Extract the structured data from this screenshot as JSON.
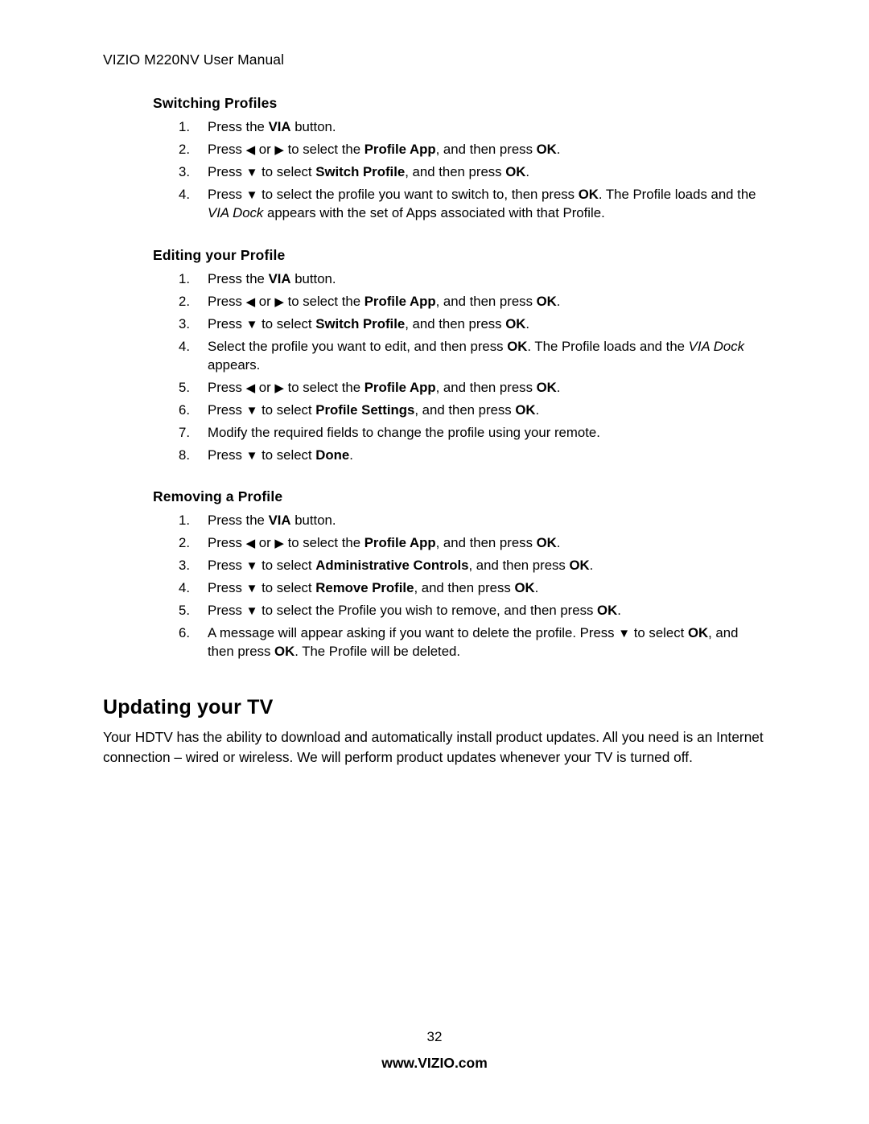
{
  "header": {
    "running_head": "VIZIO M220NV User Manual"
  },
  "sections": [
    {
      "heading": "Switching Profiles",
      "steps": [
        {
          "num": "1.",
          "html": "Press the <b>VIA</b> button."
        },
        {
          "num": "2.",
          "html": "Press <span class=\"tri\">&#9664;</span> or <span class=\"tri\">&#9654;</span> to select the <b>Profile App</b>, and then press <b>OK</b>."
        },
        {
          "num": "3.",
          "html": "Press <span class=\"tri\">&#9660;</span> to select <b>Switch Profile</b>, and then press <b>OK</b>."
        },
        {
          "num": "4.",
          "html": "Press <span class=\"tri\">&#9660;</span> to select the profile you want to switch to, then press <b>OK</b>. The Profile loads and the <i>VIA Dock</i> appears with the set of Apps associated with that Profile."
        }
      ]
    },
    {
      "heading": "Editing your Profile",
      "steps": [
        {
          "num": "1.",
          "html": "Press the <b>VIA</b> button."
        },
        {
          "num": "2.",
          "html": "Press <span class=\"tri\">&#9664;</span> or <span class=\"tri\">&#9654;</span> to select the <b>Profile App</b>, and then press <b>OK</b>."
        },
        {
          "num": "3.",
          "html": "Press <span class=\"tri\">&#9660;</span> to select <b>Switch Profile</b>, and then press <b>OK</b>."
        },
        {
          "num": "4.",
          "html": "Select the profile you want to edit, and then press <b>OK</b>. The Profile loads and the <i>VIA Dock</i> appears."
        },
        {
          "num": "5.",
          "html": "Press <span class=\"tri\">&#9664;</span> or <span class=\"tri\">&#9654;</span> to select the <b>Profile App</b>, and then press <b>OK</b>."
        },
        {
          "num": "6.",
          "html": "Press <span class=\"tri\">&#9660;</span> to select <b>Profile Settings</b>, and then press <b>OK</b>."
        },
        {
          "num": "7.",
          "html": "Modify the required fields to change the profile using your remote."
        },
        {
          "num": "8.",
          "html": "Press <span class=\"tri\">&#9660;</span> to select <b>Done</b>."
        }
      ]
    },
    {
      "heading": "Removing a Profile",
      "steps": [
        {
          "num": "1.",
          "html": "Press the <b>VIA</b> button."
        },
        {
          "num": "2.",
          "html": "Press <span class=\"tri\">&#9664;</span> or <span class=\"tri\">&#9654;</span> to select the <b>Profile App</b>, and then press <b>OK</b>."
        },
        {
          "num": "3.",
          "html": "Press <span class=\"tri\">&#9660;</span> to select <b>Administrative Controls</b>, and then press <b>OK</b>."
        },
        {
          "num": "4.",
          "html": "Press <span class=\"tri\">&#9660;</span> to select <b>Remove Profile</b>, and then press <b>OK</b>."
        },
        {
          "num": "5.",
          "html": "Press <span class=\"tri\">&#9660;</span> to select the Profile you wish to remove, and then press <b>OK</b>."
        },
        {
          "num": "6.",
          "html": "A message will appear asking if you want to delete the profile. Press <span class=\"tri\">&#9660;</span> to select <b>OK</b>, and then press <b>OK</b>. The Profile will be deleted."
        }
      ]
    }
  ],
  "updating": {
    "heading": "Updating your TV",
    "paragraph": "Your HDTV has the ability to download and automatically install product updates. All you need is an Internet connection – wired or wireless. We will perform product updates whenever your TV is turned off."
  },
  "footer": {
    "page_number": "32",
    "url": "www.VIZIO.com"
  }
}
